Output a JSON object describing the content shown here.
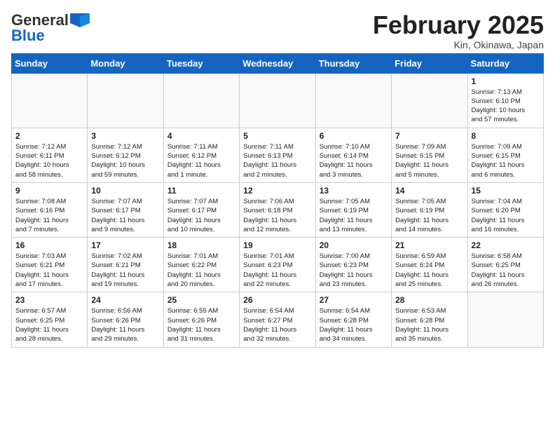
{
  "header": {
    "logo_general": "General",
    "logo_blue": "Blue",
    "month": "February 2025",
    "location": "Kin, Okinawa, Japan"
  },
  "weekdays": [
    "Sunday",
    "Monday",
    "Tuesday",
    "Wednesday",
    "Thursday",
    "Friday",
    "Saturday"
  ],
  "weeks": [
    [
      {
        "day": "",
        "info": ""
      },
      {
        "day": "",
        "info": ""
      },
      {
        "day": "",
        "info": ""
      },
      {
        "day": "",
        "info": ""
      },
      {
        "day": "",
        "info": ""
      },
      {
        "day": "",
        "info": ""
      },
      {
        "day": "1",
        "info": "Sunrise: 7:13 AM\nSunset: 6:10 PM\nDaylight: 10 hours\nand 57 minutes."
      }
    ],
    [
      {
        "day": "2",
        "info": "Sunrise: 7:12 AM\nSunset: 6:11 PM\nDaylight: 10 hours\nand 58 minutes."
      },
      {
        "day": "3",
        "info": "Sunrise: 7:12 AM\nSunset: 6:12 PM\nDaylight: 10 hours\nand 59 minutes."
      },
      {
        "day": "4",
        "info": "Sunrise: 7:11 AM\nSunset: 6:12 PM\nDaylight: 11 hours\nand 1 minute."
      },
      {
        "day": "5",
        "info": "Sunrise: 7:11 AM\nSunset: 6:13 PM\nDaylight: 11 hours\nand 2 minutes."
      },
      {
        "day": "6",
        "info": "Sunrise: 7:10 AM\nSunset: 6:14 PM\nDaylight: 11 hours\nand 3 minutes."
      },
      {
        "day": "7",
        "info": "Sunrise: 7:09 AM\nSunset: 6:15 PM\nDaylight: 11 hours\nand 5 minutes."
      },
      {
        "day": "8",
        "info": "Sunrise: 7:09 AM\nSunset: 6:15 PM\nDaylight: 11 hours\nand 6 minutes."
      }
    ],
    [
      {
        "day": "9",
        "info": "Sunrise: 7:08 AM\nSunset: 6:16 PM\nDaylight: 11 hours\nand 7 minutes."
      },
      {
        "day": "10",
        "info": "Sunrise: 7:07 AM\nSunset: 6:17 PM\nDaylight: 11 hours\nand 9 minutes."
      },
      {
        "day": "11",
        "info": "Sunrise: 7:07 AM\nSunset: 6:17 PM\nDaylight: 11 hours\nand 10 minutes."
      },
      {
        "day": "12",
        "info": "Sunrise: 7:06 AM\nSunset: 6:18 PM\nDaylight: 11 hours\nand 12 minutes."
      },
      {
        "day": "13",
        "info": "Sunrise: 7:05 AM\nSunset: 6:19 PM\nDaylight: 11 hours\nand 13 minutes."
      },
      {
        "day": "14",
        "info": "Sunrise: 7:05 AM\nSunset: 6:19 PM\nDaylight: 11 hours\nand 14 minutes."
      },
      {
        "day": "15",
        "info": "Sunrise: 7:04 AM\nSunset: 6:20 PM\nDaylight: 11 hours\nand 16 minutes."
      }
    ],
    [
      {
        "day": "16",
        "info": "Sunrise: 7:03 AM\nSunset: 6:21 PM\nDaylight: 11 hours\nand 17 minutes."
      },
      {
        "day": "17",
        "info": "Sunrise: 7:02 AM\nSunset: 6:21 PM\nDaylight: 11 hours\nand 19 minutes."
      },
      {
        "day": "18",
        "info": "Sunrise: 7:01 AM\nSunset: 6:22 PM\nDaylight: 11 hours\nand 20 minutes."
      },
      {
        "day": "19",
        "info": "Sunrise: 7:01 AM\nSunset: 6:23 PM\nDaylight: 11 hours\nand 22 minutes."
      },
      {
        "day": "20",
        "info": "Sunrise: 7:00 AM\nSunset: 6:23 PM\nDaylight: 11 hours\nand 23 minutes."
      },
      {
        "day": "21",
        "info": "Sunrise: 6:59 AM\nSunset: 6:24 PM\nDaylight: 11 hours\nand 25 minutes."
      },
      {
        "day": "22",
        "info": "Sunrise: 6:58 AM\nSunset: 6:25 PM\nDaylight: 11 hours\nand 26 minutes."
      }
    ],
    [
      {
        "day": "23",
        "info": "Sunrise: 6:57 AM\nSunset: 6:25 PM\nDaylight: 11 hours\nand 28 minutes."
      },
      {
        "day": "24",
        "info": "Sunrise: 6:56 AM\nSunset: 6:26 PM\nDaylight: 11 hours\nand 29 minutes."
      },
      {
        "day": "25",
        "info": "Sunrise: 6:55 AM\nSunset: 6:26 PM\nDaylight: 11 hours\nand 31 minutes."
      },
      {
        "day": "26",
        "info": "Sunrise: 6:54 AM\nSunset: 6:27 PM\nDaylight: 11 hours\nand 32 minutes."
      },
      {
        "day": "27",
        "info": "Sunrise: 6:54 AM\nSunset: 6:28 PM\nDaylight: 11 hours\nand 34 minutes."
      },
      {
        "day": "28",
        "info": "Sunrise: 6:53 AM\nSunset: 6:28 PM\nDaylight: 11 hours\nand 35 minutes."
      },
      {
        "day": "",
        "info": ""
      }
    ]
  ]
}
